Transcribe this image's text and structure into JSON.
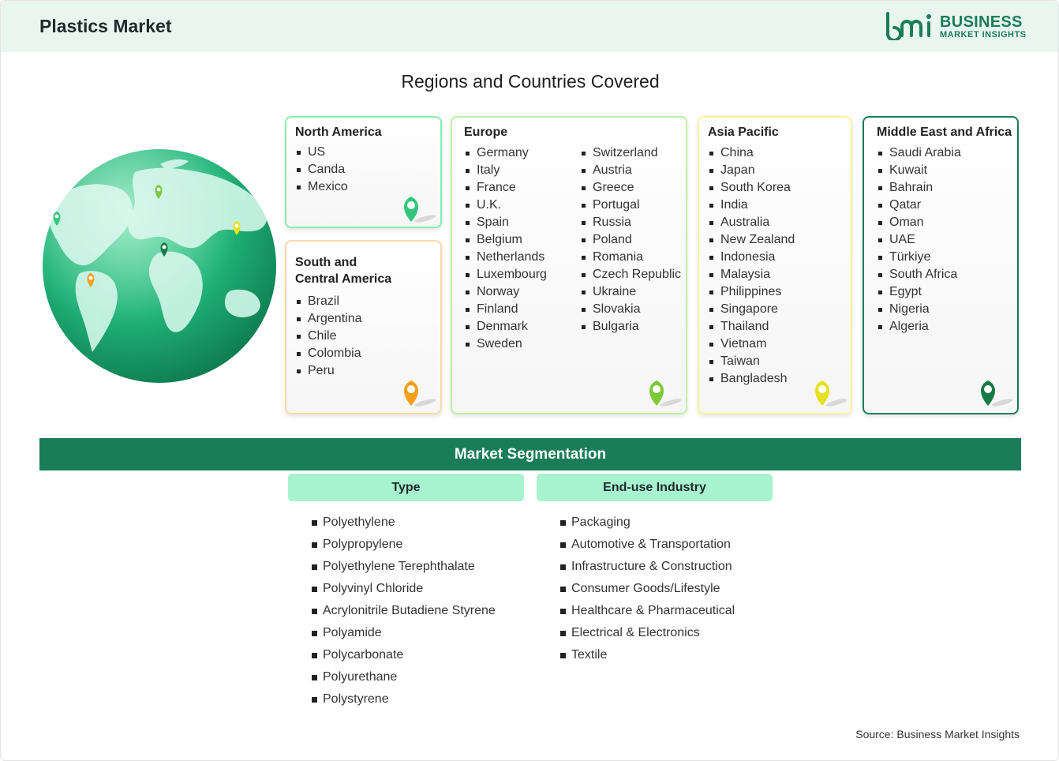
{
  "header": {
    "title": "Plastics Market"
  },
  "logo": {
    "line1": "BUSINESS",
    "line2": "MARKET INSIGHTS",
    "color": "#1a7d5a"
  },
  "regions_title": "Regions and Countries Covered",
  "regions": {
    "north_america": {
      "title": "North America",
      "countries": [
        "US",
        "Canda",
        "Mexico"
      ],
      "color": "#86efac",
      "pin_color": "#34c77b"
    },
    "south_central_america": {
      "title_line1": "South and",
      "title_line2": "Central America",
      "countries": [
        "Brazil",
        "Argentina",
        "Chile",
        "Colombia",
        "Peru"
      ],
      "color": "#fcd9a8",
      "pin_color": "#f4a01c"
    },
    "europe": {
      "title": "Europe",
      "countries_col1": [
        "Germany",
        "Italy",
        "France",
        "U.K.",
        "Spain",
        "Belgium",
        "Netherlands",
        "Luxembourg",
        "Norway",
        "Finland",
        "Denmark",
        "Sweden"
      ],
      "countries_col2": [
        "Switzerland",
        "Austria",
        "Greece",
        "Portugal",
        "Russia",
        "Poland",
        "Romania",
        "Czech Republic",
        "Ukraine",
        "Slovakia",
        "Bulgaria"
      ],
      "color": "#bbf0a8",
      "pin_color": "#7cc93a"
    },
    "asia_pacific": {
      "title": "Asia Pacific",
      "countries": [
        "China",
        "Japan",
        "South Korea",
        "India",
        "Australia",
        "New Zealand",
        "Indonesia",
        "Malaysia",
        "Philippines",
        "Singapore",
        "Thailand",
        "Vietnam",
        "Taiwan",
        "Bangladesh"
      ],
      "color": "#f7f29a",
      "pin_color": "#e4e21f"
    },
    "middle_east_africa": {
      "title": "Middle East and Africa",
      "countries": [
        "Saudi Arabia",
        "Kuwait",
        "Bahrain",
        "Qatar",
        "Oman",
        "UAE",
        "Türkiye",
        "South Africa",
        "Egypt",
        "Nigeria",
        "Algeria"
      ],
      "color": "#1a7d5a",
      "pin_color": "#177a45"
    }
  },
  "segmentation": {
    "title": "Market Segmentation",
    "type": {
      "title": "Type",
      "items": [
        "Polyethylene",
        "Polypropylene",
        "Polyethylene Terephthalate",
        "Polyvinyl Chloride",
        "Acrylonitrile Butadiene Styrene",
        "Polyamide",
        "Polycarbonate",
        "Polyurethane",
        "Polystyrene"
      ]
    },
    "end_use": {
      "title": "End-use Industry",
      "items": [
        "Packaging",
        "Automotive & Transportation",
        "Infrastructure & Construction",
        "Consumer Goods/Lifestyle",
        "Healthcare & Pharmaceutical",
        "Electrical & Electronics",
        "Textile"
      ]
    }
  },
  "source": "Source: Business Market Insights"
}
